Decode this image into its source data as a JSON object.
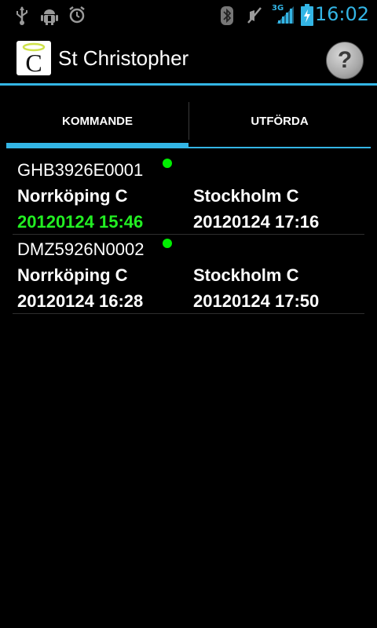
{
  "status_bar": {
    "time": "16:02",
    "network": "3G",
    "icons": [
      "usb-icon",
      "android-debug-icon",
      "alarm-icon",
      "bluetooth-icon",
      "mute-icon",
      "signal-icon",
      "battery-charging-icon"
    ]
  },
  "app": {
    "title": "St Christopher",
    "logo_letter": "C",
    "help_label": "?"
  },
  "tabs": [
    {
      "label": "KOMMANDE"
    },
    {
      "label": "UTFÖRDA"
    }
  ],
  "trips": [
    {
      "id": "GHB3926E0001",
      "from": "Norrköping C",
      "to": "Stockholm C",
      "departure": "20120124 15:46",
      "arrival": "20120124 17:16"
    },
    {
      "id": "DMZ5926N0002",
      "from": "Norrköping C",
      "to": "Stockholm C",
      "departure": "20120124 16:28",
      "arrival": "20120124 17:50"
    }
  ],
  "colors": {
    "accent": "#33b5e5",
    "active_dot": "#00ee00",
    "active_time": "#22ee22"
  }
}
